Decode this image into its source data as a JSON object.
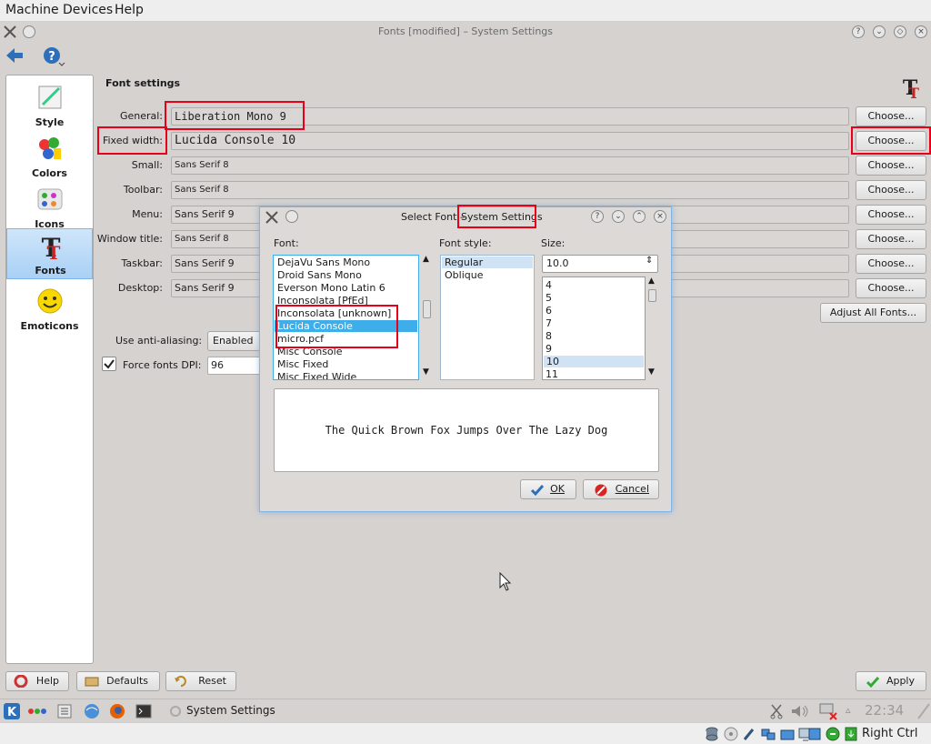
{
  "vm_menu": {
    "items": [
      "Machine",
      "Devices",
      "Help"
    ]
  },
  "window": {
    "title": "Fonts [modified] – System Settings"
  },
  "sidebar": {
    "items": [
      {
        "label": "Style",
        "icon": "style-icon"
      },
      {
        "label": "Colors",
        "icon": "colors-icon"
      },
      {
        "label": "Icons",
        "icon": "icons-icon"
      },
      {
        "label": "Fonts",
        "icon": "fonts-icon",
        "selected": true
      },
      {
        "label": "Emoticons",
        "icon": "emoticons-icon"
      }
    ]
  },
  "font_settings": {
    "heading": "Font settings",
    "rows": [
      {
        "label": "General:",
        "value": "Liberation Mono 9",
        "button": "Choose..."
      },
      {
        "label": "Fixed width:",
        "value": "Lucida Console 10",
        "button": "Choose..."
      },
      {
        "label": "Small:",
        "value": "Sans Serif 8",
        "button": "Choose..."
      },
      {
        "label": "Toolbar:",
        "value": "Sans Serif 8",
        "button": "Choose..."
      },
      {
        "label": "Menu:",
        "value": "Sans Serif 9",
        "button": "Choose..."
      },
      {
        "label": "Window title:",
        "value": "Sans Serif 8",
        "button": "Choose..."
      },
      {
        "label": "Taskbar:",
        "value": "Sans Serif 9",
        "button": "Choose..."
      },
      {
        "label": "Desktop:",
        "value": "Sans Serif 9",
        "button": "Choose..."
      }
    ],
    "adjust_all": "Adjust All Fonts...",
    "anti_aliasing_label": "Use anti-aliasing:",
    "anti_aliasing_value": "Enabled",
    "force_dpi_label": "Force fonts DPI:",
    "force_dpi_value": "96"
  },
  "dialog": {
    "title_prefix": "Select Font –",
    "title_app": "System Settings",
    "font_label": "Font:",
    "style_label": "Font style:",
    "size_label": "Size:",
    "fonts": [
      "DejaVu Sans Mono",
      "Droid Sans Mono",
      "Everson Mono Latin 6",
      "Inconsolata [PfEd]",
      "Inconsolata [unknown]",
      "Lucida Console",
      "micro.pcf",
      "Misc Console",
      "Misc Fixed",
      "Misc Fixed Wide"
    ],
    "selected_font": "Lucida Console",
    "styles": [
      "Regular",
      "Oblique"
    ],
    "size_value": "10.0",
    "sizes": [
      "4",
      "5",
      "6",
      "7",
      "8",
      "9",
      "10",
      "11"
    ],
    "selected_size": "10",
    "preview_text": "The Quick Brown Fox Jumps Over The Lazy Dog",
    "ok": "OK",
    "cancel": "Cancel"
  },
  "bottom_buttons": {
    "help": "Help",
    "defaults": "Defaults",
    "reset": "Reset",
    "apply": "Apply"
  },
  "taskbar": {
    "task": "System Settings",
    "clock": "22:34"
  },
  "statusbar": {
    "host_key": "Right Ctrl"
  },
  "colors": {
    "selection": "#3daee9",
    "highlight_box": "#e8001a",
    "accent": "#7fb5e8"
  }
}
